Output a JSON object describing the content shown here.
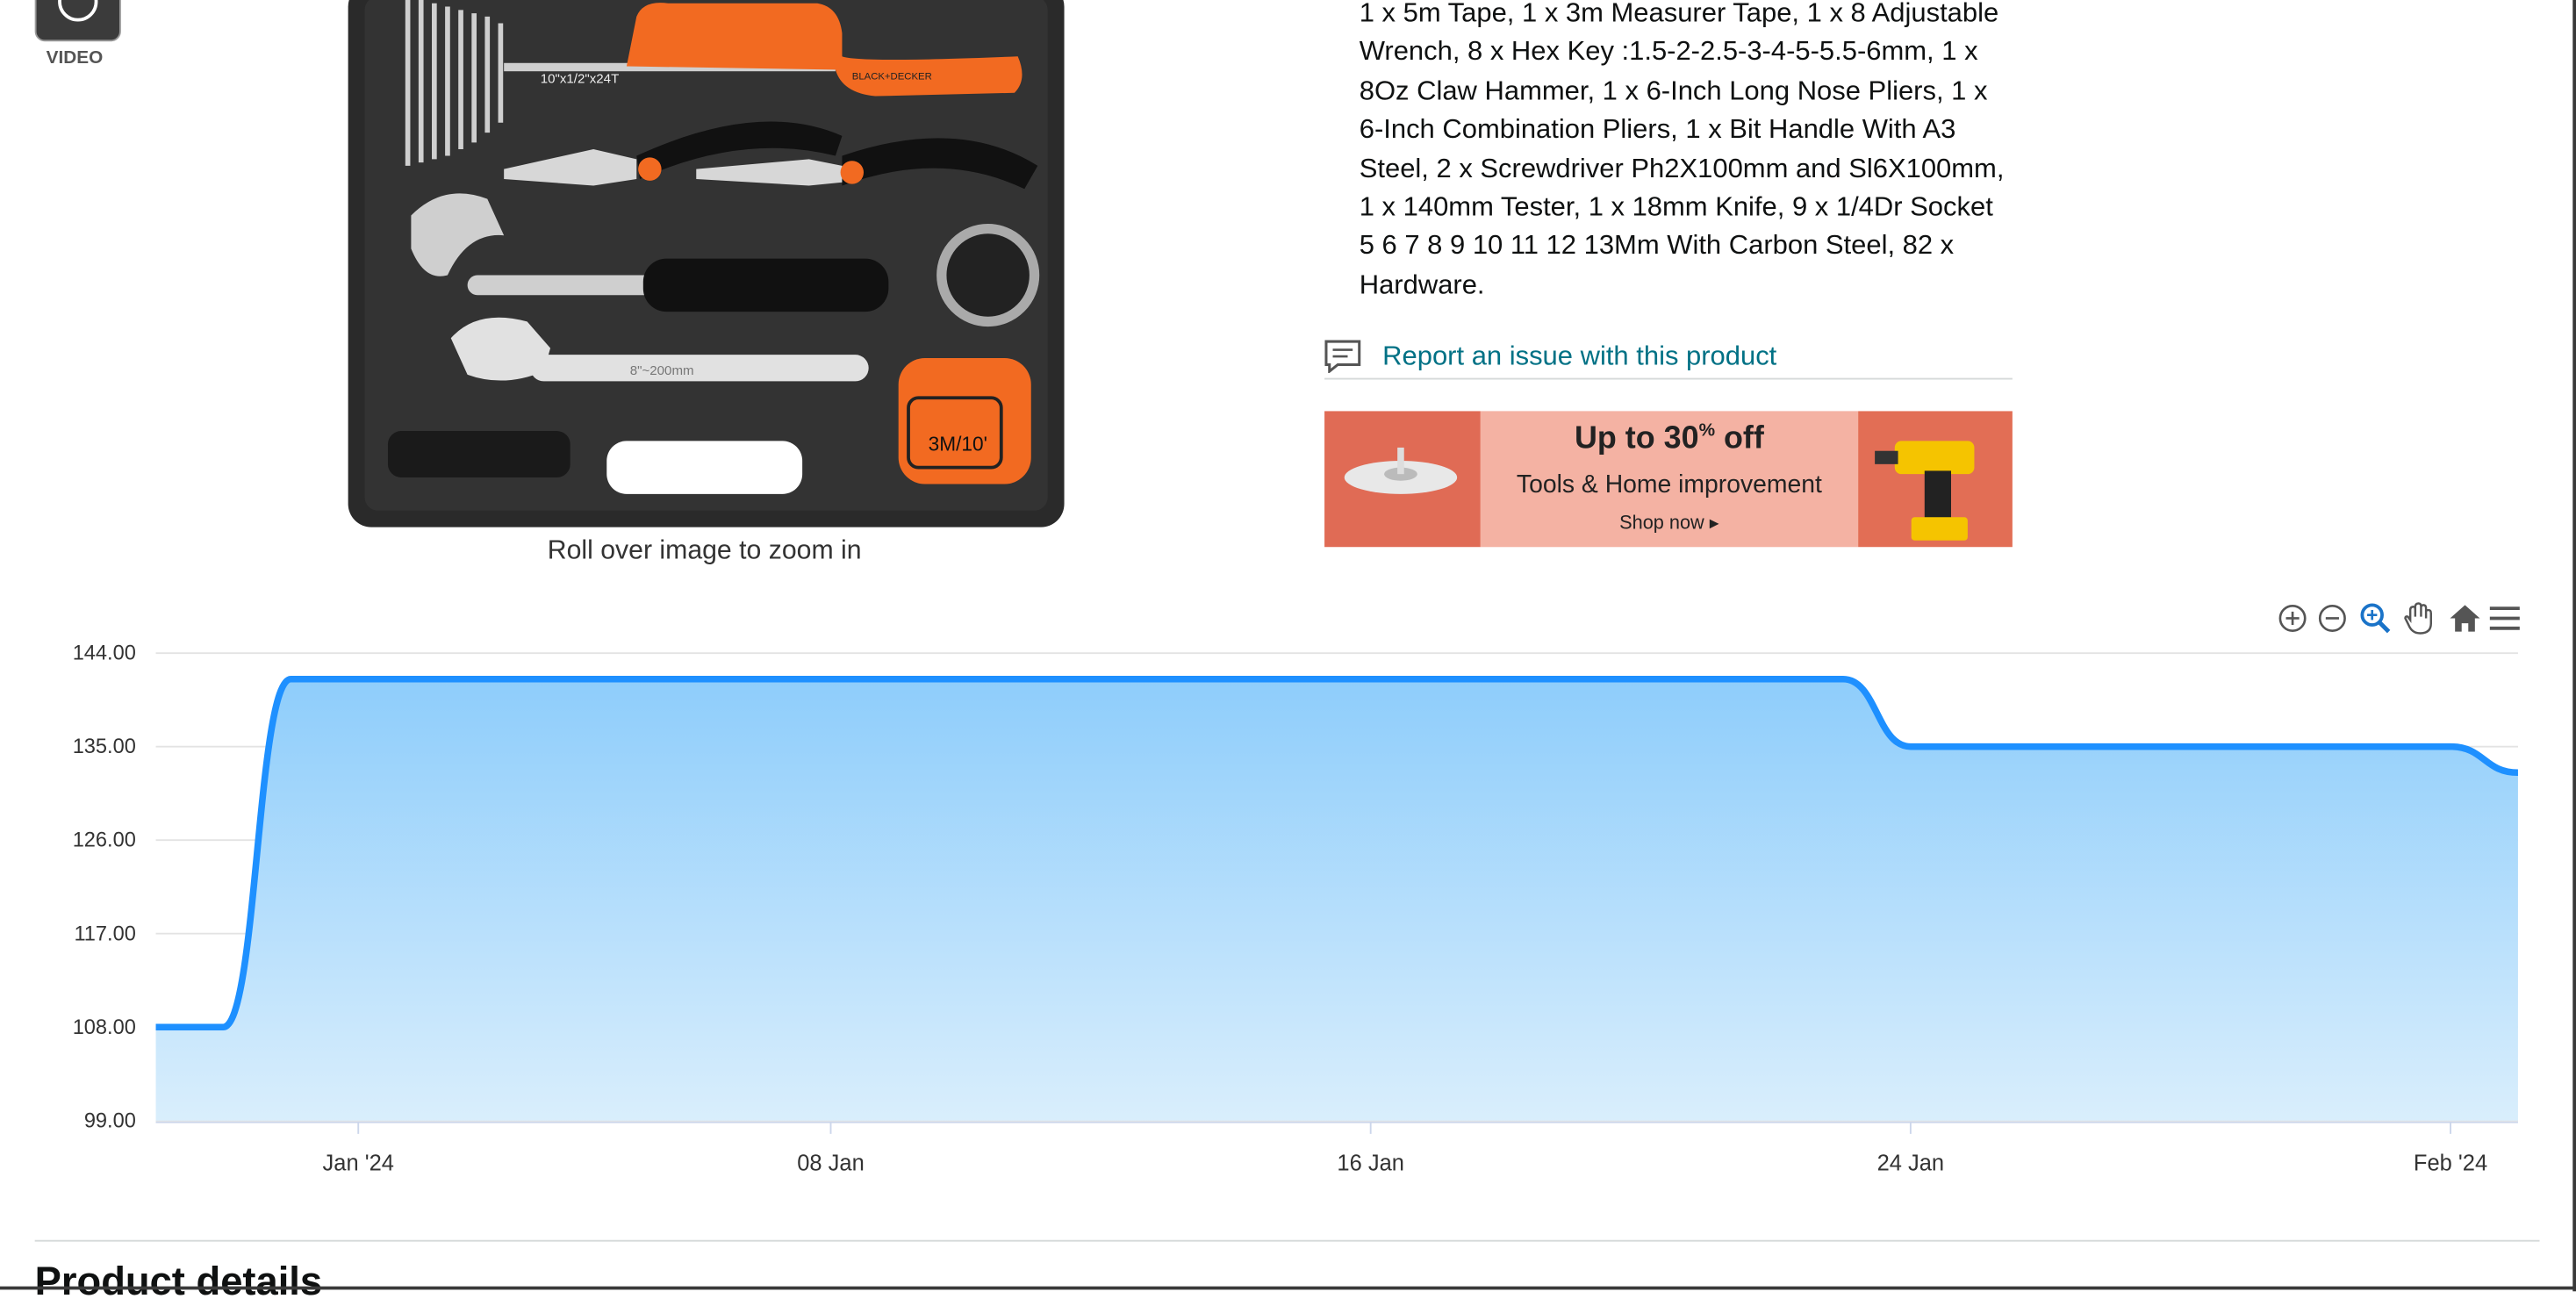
{
  "media": {
    "video_label": "VIDEO",
    "zoom_hint": "Roll over image to zoom in",
    "image_text": {
      "saw_blade": "10\"x1/2\"x24T",
      "wrench_marking": "8\"~200mm",
      "tape_marking": "3M/10'",
      "brand": "BLACK+DECKER"
    }
  },
  "description": {
    "lines": [
      "1 x 5m Tape, 1 x 3m Measurer Tape, 1 x 8 Adjustable",
      "Wrench, 8 x Hex Key :1.5-2-2.5-3-4-5-5.5-6mm, 1 x",
      "8Oz Claw Hammer, 1 x 6-Inch Long Nose Pliers, 1 x",
      "6-Inch Combination Pliers, 1 x Bit Handle With A3",
      "Steel, 2 x Screwdriver Ph2X100mm and Sl6X100mm,",
      "1 x 140mm Tester, 1 x 18mm Knife, 9 x 1/4Dr Socket",
      "5 6 7 8 9 10 11 12 13Mm With Carbon Steel, 82 x",
      "Hardware."
    ]
  },
  "report": {
    "link_text": "Report an issue with this product",
    "icon": "feedback-icon"
  },
  "banner": {
    "title_main": "Up to 30",
    "title_sup": "%",
    "title_tail": " off",
    "subtitle": "Tools & Home improvement",
    "cta": "Shop now ▸"
  },
  "toolbar": {
    "icons": [
      "zoom-in-icon",
      "zoom-out-icon",
      "magnifier-icon",
      "pan-hand-icon",
      "home-icon",
      "menu-icon"
    ],
    "accent": "#1a73c8"
  },
  "chart_data": {
    "type": "area",
    "x": [
      "2023-12-29",
      "2023-12-30",
      "2023-12-31",
      "2024-01-23",
      "2024-01-24",
      "2024-02-01",
      "2024-02-02"
    ],
    "values": [
      108,
      108,
      141.5,
      141.5,
      135,
      135,
      132.5
    ],
    "xticks": [
      "Jan '24",
      "08 Jan",
      "16 Jan",
      "24 Jan",
      "Feb '24"
    ],
    "xtick_dates": [
      "2024-01-01",
      "2024-01-08",
      "2024-01-16",
      "2024-01-24",
      "2024-02-01"
    ],
    "yticks": [
      "144.00",
      "135.00",
      "126.00",
      "117.00",
      "108.00",
      "99.00"
    ],
    "ylim": [
      99,
      144
    ],
    "xlim": [
      "2023-12-29",
      "2024-02-02"
    ],
    "grid": true,
    "line_color": "#1e90ff",
    "fill_top": "#8ecdfb",
    "fill_bottom": "#d9eefc"
  },
  "section": {
    "title": "Product details"
  }
}
